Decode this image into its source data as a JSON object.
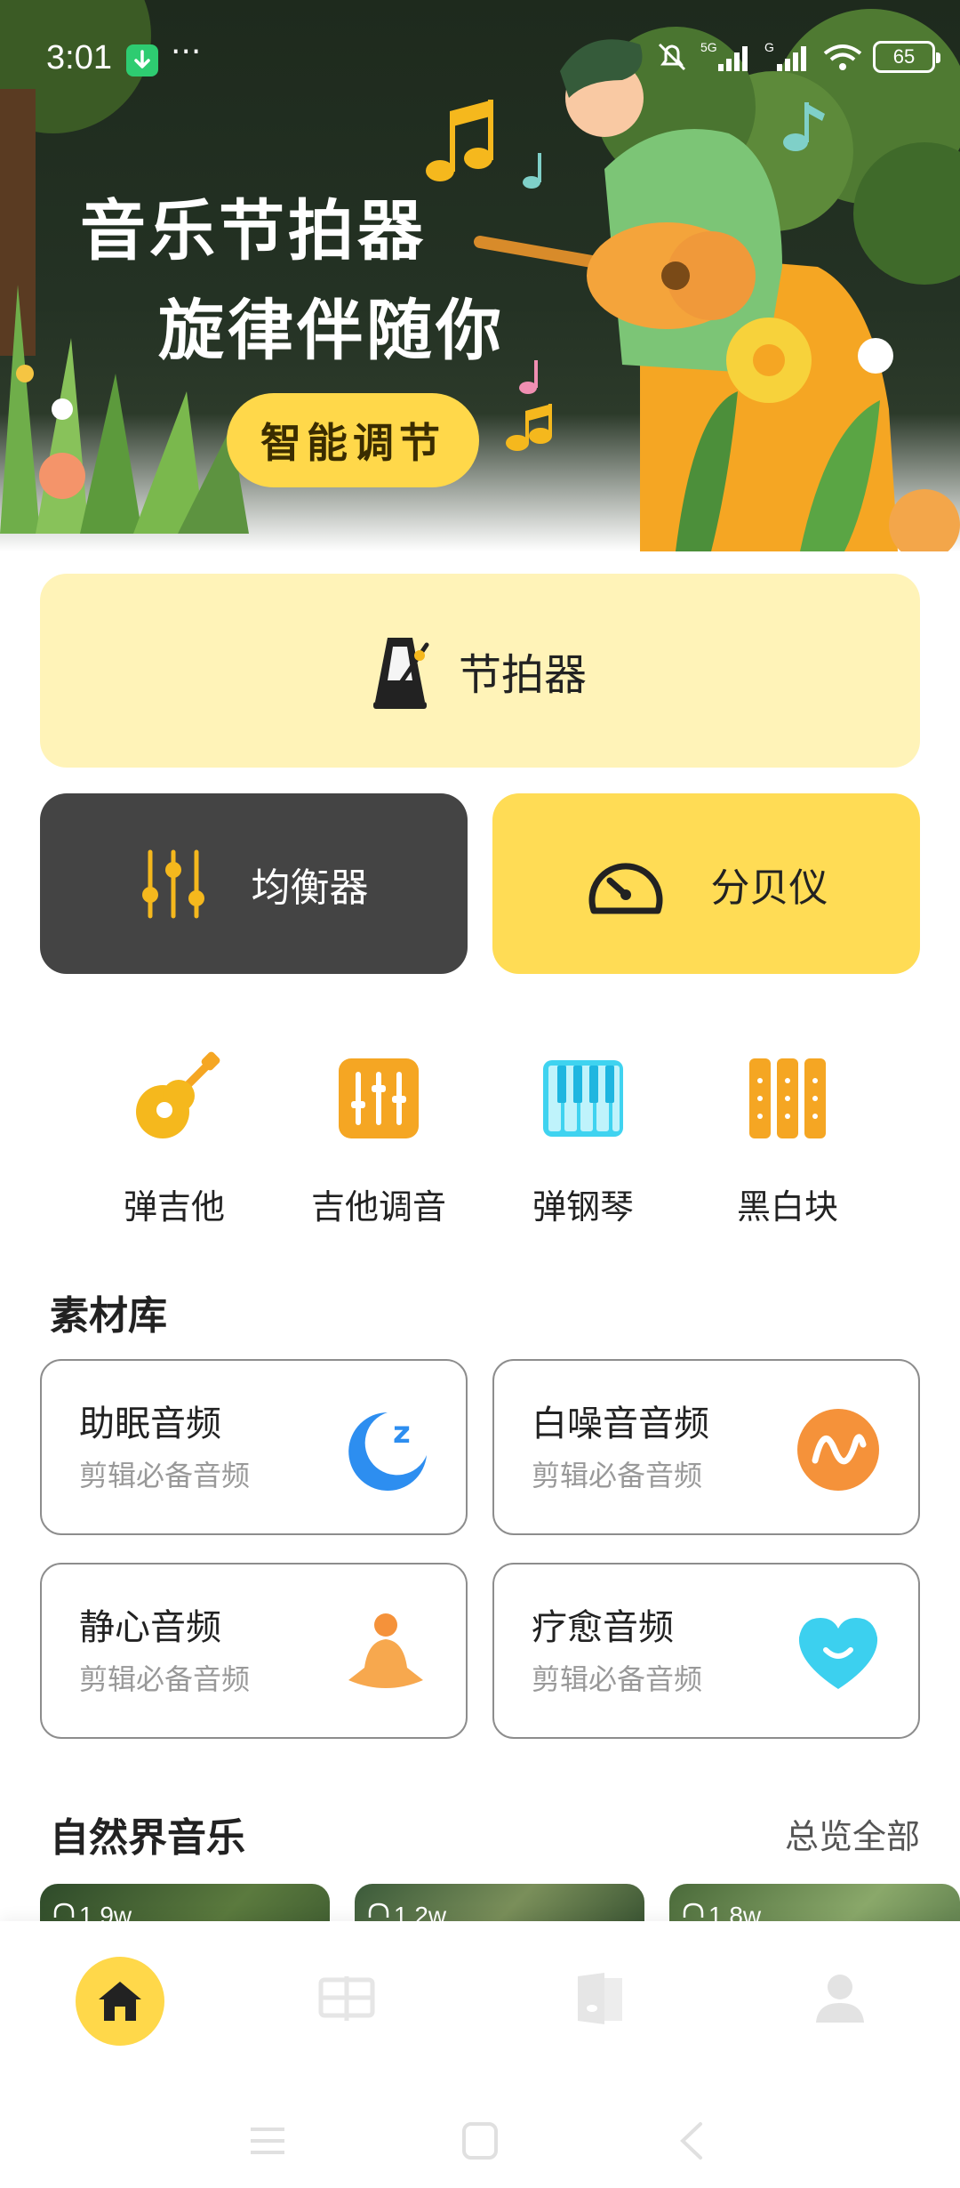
{
  "status_bar": {
    "time": "3:01",
    "dots": "···",
    "battery": "65",
    "network_labels": [
      "5G",
      "G"
    ]
  },
  "hero": {
    "title_line1": "音乐节拍器",
    "title_line2": "旋律伴随你",
    "button_label": "智能调节"
  },
  "metronome": {
    "label": "节拍器",
    "icon": "metronome-icon"
  },
  "equalizer": {
    "label": "均衡器",
    "icon": "equalizer-sliders-icon"
  },
  "decibel": {
    "label": "分贝仪",
    "icon": "gauge-icon"
  },
  "tools": [
    {
      "label": "弹吉他",
      "icon": "guitar-icon"
    },
    {
      "label": "吉他调音",
      "icon": "tuner-icon"
    },
    {
      "label": "弹钢琴",
      "icon": "piano-icon"
    },
    {
      "label": "黑白块",
      "icon": "tiles-icon"
    }
  ],
  "library": {
    "title": "素材库",
    "items": [
      {
        "title": "助眠音频",
        "subtitle": "剪辑必备音频",
        "icon": "moon-sleep-icon"
      },
      {
        "title": "白噪音音频",
        "subtitle": "剪辑必备音频",
        "icon": "wave-icon"
      },
      {
        "title": "静心音频",
        "subtitle": "剪辑必备音频",
        "icon": "meditation-icon"
      },
      {
        "title": "疗愈音频",
        "subtitle": "剪辑必备音频",
        "icon": "heart-smile-icon"
      }
    ]
  },
  "nature": {
    "title": "自然界音乐",
    "see_all": "总览全部",
    "items": [
      {
        "count": "1.9w"
      },
      {
        "count": "1.2w"
      },
      {
        "count": "1.8w"
      }
    ]
  },
  "bottom_nav": [
    "home-icon",
    "library-icon",
    "music-book-icon",
    "profile-icon"
  ],
  "colors": {
    "accent": "#ffd84a",
    "dark_tile": "#444444",
    "metronome_bg": "#fff3b8"
  }
}
